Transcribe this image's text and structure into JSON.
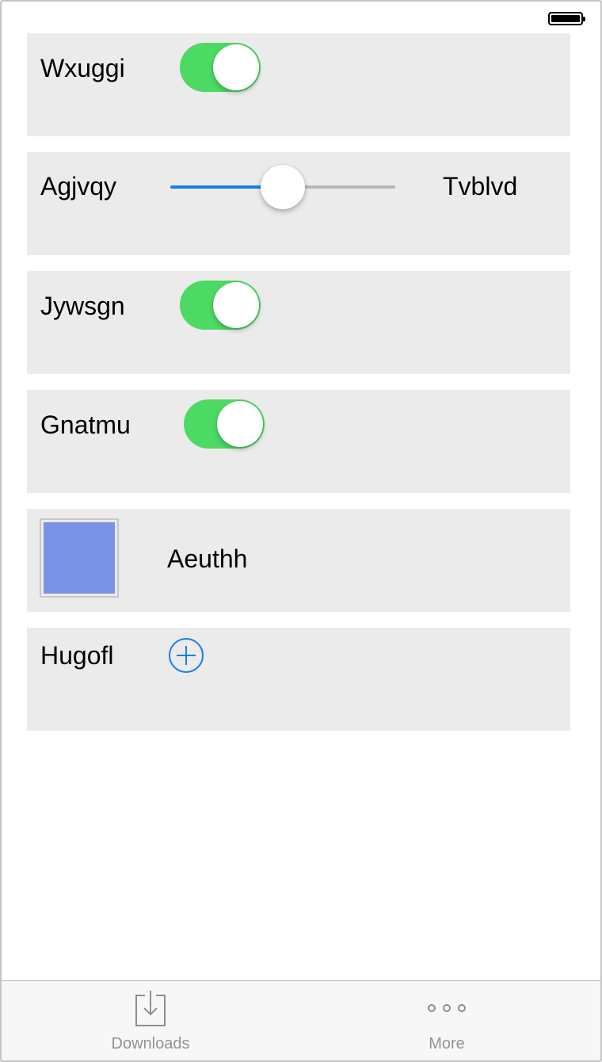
{
  "status_bar": {
    "battery_icon": "battery-full-icon"
  },
  "rows": {
    "r1": {
      "label": "Wxuggi",
      "toggle_on": true
    },
    "r2": {
      "label": "Agjvqy",
      "slider_value": 0.5,
      "slider_right_label": "Tvblvd"
    },
    "r3": {
      "label": "Jywsgn",
      "toggle_on": true
    },
    "r4": {
      "label": "Gnatmu",
      "toggle_on": true
    },
    "r5": {
      "label": "Aeuthh",
      "swatch_color": "#7a93e6"
    },
    "r6": {
      "label": "Hugofl",
      "add_icon": "plus-circle-icon"
    }
  },
  "colors": {
    "toggle_on": "#4cd964",
    "slider_fill": "#1a7ee8",
    "row_background": "#ebebeb",
    "accent": "#1a7ee8"
  },
  "tabbar": {
    "tabs": [
      {
        "label": "Downloads",
        "icon": "download-tray-icon"
      },
      {
        "label": "More",
        "icon": "more-dots-icon"
      }
    ]
  }
}
